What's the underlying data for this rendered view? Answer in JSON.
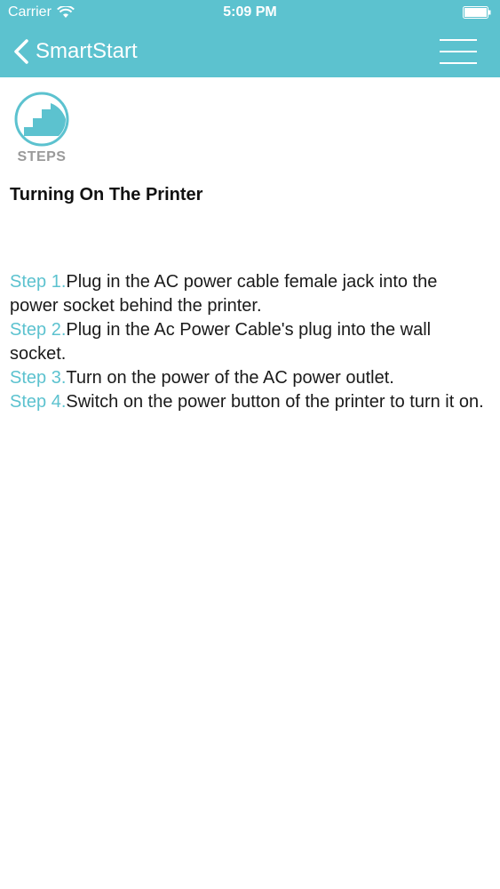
{
  "status_bar": {
    "carrier": "Carrier",
    "time": "5:09 PM"
  },
  "nav": {
    "back_label": "SmartStart",
    "accent_color": "#5cc2cf"
  },
  "logo": {
    "label": "STEPS",
    "icon": "stairs-icon"
  },
  "page": {
    "title": "Turning On The Printer"
  },
  "steps": [
    {
      "num": "Step 1.",
      "text": "Plug in the AC power cable female jack into the power socket behind the printer."
    },
    {
      "num": "Step 2.",
      "text": "Plug in the Ac Power Cable's plug into the wall socket."
    },
    {
      "num": "Step 3.",
      "text": "Turn on the power of the AC power outlet."
    },
    {
      "num": "Step 4.",
      "text": "Switch on the power button of the printer to turn it on."
    }
  ]
}
